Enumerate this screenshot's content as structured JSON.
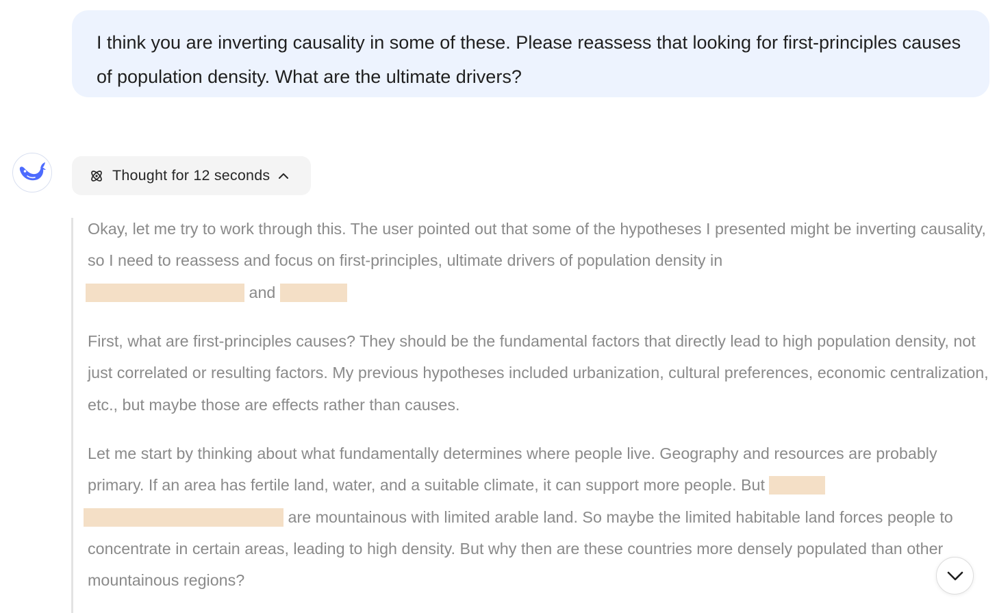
{
  "user_message": {
    "text": "I think you are inverting causality in some of these. Please reassess that looking for first-principles causes of population density. What are the ultimate drivers?"
  },
  "assistant": {
    "avatar_icon": "whale-logo-icon",
    "brand_color": "#4d6bfe",
    "thought_toggle": {
      "icon": "atom-icon",
      "label": "Thought for 12 seconds",
      "chevron_icon": "chevron-up-icon"
    },
    "thinking": {
      "p1": {
        "text_a": "Okay, let me try to work through this. The user pointed out that some of the hypotheses I presented might be inverting causality, so I need to reassess and focus on first-principles, ultimate drivers of population density in",
        "text_b": "and"
      },
      "p2": {
        "text": "First, what are first-principles causes? They should be the fundamental factors that directly lead to high population density, not just correlated or resulting factors. My previous hypotheses included urbanization, cultural preferences, economic centralization, etc., but maybe those are effects rather than causes."
      },
      "p3": {
        "text_a": "Let me start by thinking about what fundamentally determines where people live. Geography and resources are probably primary. If an area has fertile land, water, and a suitable climate, it can support more people. But",
        "text_b": "are mountainous with limited arable land. So maybe the limited habitable land forces people to concentrate in certain areas, leading to high density. But why then are these countries more densely populated than other mountainous regions?"
      }
    }
  },
  "scroll_down_icon": "chevron-down-icon",
  "colors": {
    "user_bubble": "#edf3fe",
    "redaction": "#f4dfc6",
    "thinking_text": "#8a8a8a"
  }
}
